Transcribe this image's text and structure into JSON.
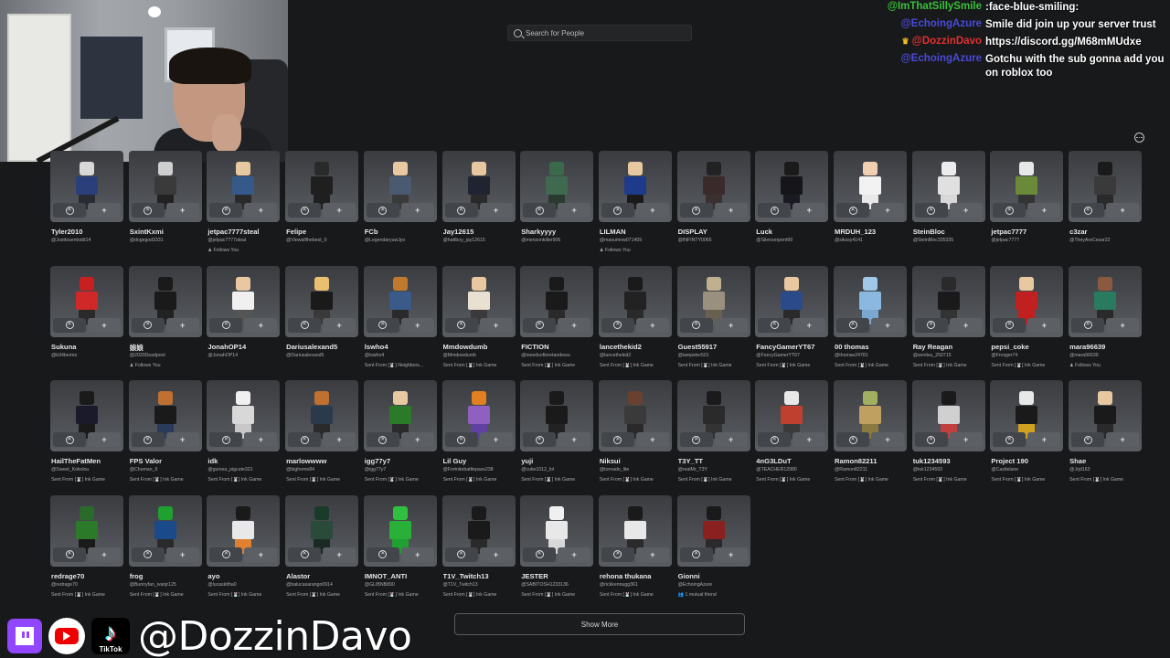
{
  "search": {
    "placeholder": "Search for People"
  },
  "chat": [
    {
      "user": "@ImThatSillySmile",
      "user_color": "#39c039",
      "message": ":face-blue-smiling:"
    },
    {
      "user": "@EchoingAzure",
      "user_color": "#4a4ad8",
      "message": "Smile did join up your server trust"
    },
    {
      "user": "@DozzinDavo",
      "user_color": "#e03030",
      "message": "https://discord.gg/M68mMUdxe",
      "badge": "crown-icon"
    },
    {
      "user": "@EchoingAzure",
      "user_color": "#4a4ad8",
      "message": "Gotchu with the sub gonna add you on roblox too"
    }
  ],
  "friends": [
    {
      "name": "Tyler2010",
      "handle": "@Justtosentodd14",
      "extra": ""
    },
    {
      "name": "SxintKxmi",
      "handle": "@dogegod3331",
      "extra": ""
    },
    {
      "name": "jetpac7777steal",
      "handle": "@jetpac7777steal",
      "extra": "♟ Follows You"
    },
    {
      "name": "Felipe",
      "handle": "@Viewallthebest_0",
      "extra": ""
    },
    {
      "name": "FCb",
      "handle": "@LegendaryuwJyo",
      "extra": ""
    },
    {
      "name": "Jay12615",
      "handle": "@hattboy_jay12615",
      "extra": ""
    },
    {
      "name": "Sharkyyyy",
      "handle": "@mensonkiller906",
      "extra": ""
    },
    {
      "name": "LILMAN",
      "handle": "@masumnw071409",
      "extra": "♟ Follows You"
    },
    {
      "name": "DISPLAY",
      "handle": "@INFINTY0065",
      "extra": ""
    },
    {
      "name": "Luck",
      "handle": "@Silenserpent99",
      "extra": ""
    },
    {
      "name": "MRDUH_123",
      "handle": "@sikssy4141",
      "extra": ""
    },
    {
      "name": "SteinBloc",
      "handle": "@SteinBloc335335",
      "extra": ""
    },
    {
      "name": "jetpac7777",
      "handle": "@jetpac7777",
      "extra": ""
    },
    {
      "name": "c3zar",
      "handle": "@TheyAreCesar22",
      "extra": ""
    },
    {
      "name": "Sukuna",
      "handle": "@b34bernie",
      "extra": ""
    },
    {
      "name": "娘娘",
      "handle": "@2020Deadpool",
      "extra": "♟ Follows You"
    },
    {
      "name": "JonahOP14",
      "handle": "@JonahOP14",
      "extra": ""
    },
    {
      "name": "Dariusalexand5",
      "handle": "@Dariusalexand5",
      "extra": ""
    },
    {
      "name": "lswho4",
      "handle": "@lswho4",
      "extra": "Sent From [🐰] Neighbors..."
    },
    {
      "name": "Mmdowdumb",
      "handle": "@Mmdowdumb",
      "extra": "Sent From [🐰] Ink Game"
    },
    {
      "name": "FICTION",
      "handle": "@ineedsoftoretandwou",
      "extra": "Sent From [🐰] Ink Game"
    },
    {
      "name": "lancethekid2",
      "handle": "@lancethekid2",
      "extra": "Sent From [🐰] Ink Game"
    },
    {
      "name": "Guest55917",
      "handle": "@iampeter501",
      "extra": "Sent From [🐰] Ink Game"
    },
    {
      "name": "FancyGamerYT67",
      "handle": "@FancyGamerYT67",
      "extra": "Sent From [🐰] Ink Game"
    },
    {
      "name": "00 thomas",
      "handle": "@thomas24781",
      "extra": "Sent From [🐰] Ink Game"
    },
    {
      "name": "Ray Reagan",
      "handle": "@zenitsu_250715",
      "extra": "Sent From [🐰] Ink Game"
    },
    {
      "name": "pepsi_coke",
      "handle": "@Frosger74",
      "extra": "Sent From [🐰] Ink Game"
    },
    {
      "name": "mara96639",
      "handle": "@mara96639",
      "extra": "♟ Follows You"
    },
    {
      "name": "HailTheFatMen",
      "handle": "@Sweet_Kokolou",
      "extra": "Sent From [🐰] Ink Game"
    },
    {
      "name": "FPS Valor",
      "handle": "@Chuman_9",
      "extra": "Sent From [🐰] Ink Game"
    },
    {
      "name": "idk",
      "handle": "@guinea_pigcute321",
      "extra": "Sent From [🐰] Ink Game"
    },
    {
      "name": "marlowwww",
      "handle": "@bighome84",
      "extra": "Sent From [🐰] Ink Game"
    },
    {
      "name": "igg77y7",
      "handle": "@igg77y7",
      "extra": "Sent From [🐰] Ink Game"
    },
    {
      "name": "Lil Guy",
      "handle": "@Fortnitebattlepass238",
      "extra": "Sent From [🐰] Ink Game"
    },
    {
      "name": "yuji",
      "handle": "@cutie1012_lol",
      "extra": "Sent From [🐰] Ink Game"
    },
    {
      "name": "Niksui",
      "handle": "@tornado_lite",
      "extra": "Sent From [🐰] Ink Game"
    },
    {
      "name": "T3Y_TT",
      "handle": "@realMr_T3Y",
      "extra": "Sent From [🐰] Ink Game"
    },
    {
      "name": "4nG3LDuT",
      "handle": "@TEACHER12980",
      "extra": "Sent From [🐰] Ink Game"
    },
    {
      "name": "Ramon82211",
      "handle": "@Ramon82211",
      "extra": "Sent From [🐰] Ink Game"
    },
    {
      "name": "tuk1234593",
      "handle": "@tuk1234593",
      "extra": "Sent From [🐰] Ink Game"
    },
    {
      "name": "Project 190",
      "handle": "@Castlelane",
      "extra": "Sent From [🐰] Ink Game"
    },
    {
      "name": "Shae",
      "handle": "@Jrjd163",
      "extra": "Sent From [🐰] Ink Game"
    },
    {
      "name": "redrage70",
      "handle": "@redrage70",
      "extra": "Sent From [🐰] Ink Game"
    },
    {
      "name": "frog",
      "handle": "@Bunnyfan_ivanjr125",
      "extra": "Sent From [🐰] Ink Game"
    },
    {
      "name": "ayo",
      "handle": "@lucaskitha0",
      "extra": "Sent From [🐰] Ink Game"
    },
    {
      "name": "Alastor",
      "handle": "@balucasarango0914",
      "extra": "Sent From [🐰] Ink Game"
    },
    {
      "name": "IMNOT_ANTI",
      "handle": "@GLIBNB890",
      "extra": "Sent From [🐰] Ink Game"
    },
    {
      "name": "T1V_Twitch13",
      "handle": "@T1V_Twitch13",
      "extra": "Sent From [🐰] Ink Game"
    },
    {
      "name": "JESTER",
      "handle": "@SABITOSH1233136",
      "extra": "Sent From [🐰] Ink Game"
    },
    {
      "name": "rehona thukana",
      "handle": "@rickkennugg361",
      "extra": "Sent From [🐰] Ink Game"
    },
    {
      "name": "Gionni",
      "handle": "@EchoingAzure",
      "extra": "👥 1 mutual friend"
    }
  ],
  "avatar_colors": [
    [
      "#d8d8d8",
      "#2b3f7a",
      "#2a2a35"
    ],
    [
      "#cfcfcf",
      "#3a3a3a",
      "#222"
    ],
    [
      "#e8c8a0",
      "#355a8a",
      "#2a2a2a"
    ],
    [
      "#2a2a2a",
      "#1f1f1f",
      "#1f1f1f"
    ],
    [
      "#e8c8a0",
      "#4a5a70",
      "#3a3a3a"
    ],
    [
      "#e8c8a0",
      "#1f2430",
      "#2a2a2a"
    ],
    [
      "#3a6a4a",
      "#406a50",
      "#2a3a30"
    ],
    [
      "#e8c8a0",
      "#1e3a8a",
      "#1a1a1a"
    ],
    [
      "#222",
      "#3a2a2a",
      "#3a3030"
    ],
    [
      "#1a1a1a",
      "#15151a",
      "#1a1a22"
    ],
    [
      "#f0d0b0",
      "#f2f2f2",
      "#e8e8e8"
    ],
    [
      "#ececec",
      "#e0e0e0",
      "#d8d8d8"
    ],
    [
      "#e8e8e8",
      "#6a8a3a",
      "#333"
    ],
    [
      "#1a1a1a",
      "#3a3a3a",
      "#2a2a2a"
    ],
    [
      "#c82020",
      "#d02828",
      "#2a2a2a"
    ],
    [
      "#1a1a1a",
      "#1a1a1a",
      "#222"
    ],
    [
      "#e8c8a0",
      "#f0f0f0",
      "#555"
    ],
    [
      "#e8c070",
      "#1a1a1a",
      "#3a3a3a"
    ],
    [
      "#c07a30",
      "#3a5a8a",
      "#2a2a2a"
    ],
    [
      "#e8c8a0",
      "#e8e0d0",
      "#3a3a3a"
    ],
    [
      "#1a1a1a",
      "#1a1a1a",
      "#2a2a2a"
    ],
    [
      "#1a1a1a",
      "#222",
      "#2a2a2a"
    ],
    [
      "#c0b090",
      "#9a9080",
      "#6a6050"
    ],
    [
      "#e8c8a0",
      "#2a4a8a",
      "#2a2a2a"
    ],
    [
      "#a0c8e8",
      "#8ab8e0",
      "#7aa8d0"
    ],
    [
      "#2a2a2a",
      "#1a1a1a",
      "#333"
    ],
    [
      "#e8c8a0",
      "#c02020",
      "#c02020"
    ],
    [
      "#8a5a40",
      "#2a7a60",
      "#2a2a2a"
    ],
    [
      "#1a1a1a",
      "#1a1a2a",
      "#1a1a1a"
    ],
    [
      "#c07030",
      "#1a1a1a",
      "#2a3a5a"
    ],
    [
      "#f0f0f0",
      "#d8d8d8",
      "#c8c8c8"
    ],
    [
      "#c07030",
      "#2a3a4a",
      "#2a2a2a"
    ],
    [
      "#e8c8a0",
      "#2a7a2a",
      "#2a2a2a"
    ],
    [
      "#e08020",
      "#9060c0",
      "#6040a0"
    ],
    [
      "#1a1a1a",
      "#1a1a1a",
      "#222"
    ],
    [
      "#6a4030",
      "#3a3a3a",
      "#2a2a2a"
    ],
    [
      "#1a1a1a",
      "#2a2a2a",
      "#333"
    ],
    [
      "#e8e8e8",
      "#c04030",
      "#3a3a3a"
    ],
    [
      "#a0b060",
      "#c0a060",
      "#8a7a40"
    ],
    [
      "#1a1a1a",
      "#d0d0d0",
      "#c04040"
    ],
    [
      "#e8e8e8",
      "#1a1a1a",
      "#d0a020"
    ],
    [
      "#e8c8a0",
      "#1a1a1a",
      "#2a2a2a"
    ],
    [
      "#2a6a2a",
      "#2a7a2a",
      "#1a1a1a"
    ],
    [
      "#20a030",
      "#1a4a8a",
      "#2a2a2a"
    ],
    [
      "#1a1a1a",
      "#e8e8e8",
      "#e08030"
    ],
    [
      "#1a3a2a",
      "#2a4a3a",
      "#1a2a22"
    ],
    [
      "#30c040",
      "#28b038",
      "#20a030"
    ],
    [
      "#1a1a1a",
      "#1a1a1a",
      "#2a2a2a"
    ],
    [
      "#f0f0f0",
      "#e8e8e8",
      "#d8d8d8"
    ],
    [
      "#1a1a1a",
      "#e8e8e8",
      "#2a2a2a"
    ],
    [
      "#1a1a1a",
      "#8a2020",
      "#2a2a2a"
    ]
  ],
  "show_more_label": "Show More",
  "streamer_handle": "@DozzinDavo",
  "tiktok_label": "TikTok"
}
